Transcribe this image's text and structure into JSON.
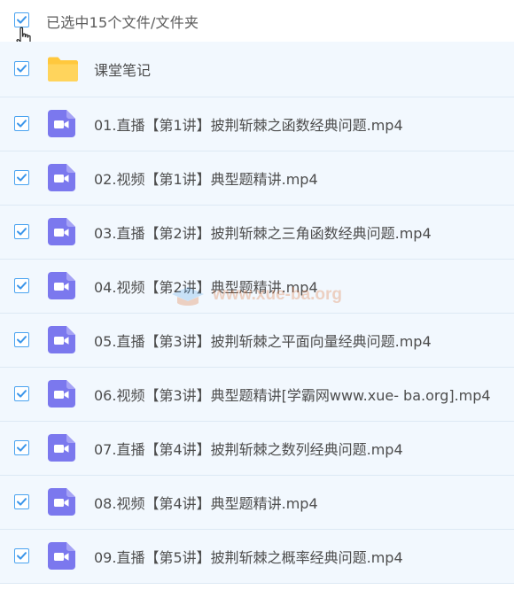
{
  "header": {
    "label": "已选中15个文件/文件夹"
  },
  "rows": [
    {
      "type": "folder",
      "label": "课堂笔记"
    },
    {
      "type": "video",
      "label": "01.直播【第1讲】披荆斩棘之函数经典问题.mp4"
    },
    {
      "type": "video",
      "label": "02.视频【第1讲】典型题精讲.mp4"
    },
    {
      "type": "video",
      "label": "03.直播【第2讲】披荆斩棘之三角函数经典问题.mp4"
    },
    {
      "type": "video",
      "label": "04.视频【第2讲】典型题精讲.mp4"
    },
    {
      "type": "video",
      "label": "05.直播【第3讲】披荆斩棘之平面向量经典问题.mp4"
    },
    {
      "type": "video",
      "label": "06.视频【第3讲】典型题精讲[学霸网www.xue- ba.org].mp4"
    },
    {
      "type": "video",
      "label": "07.直播【第4讲】披荆斩棘之数列经典问题.mp4"
    },
    {
      "type": "video",
      "label": "08.视频【第4讲】典型题精讲.mp4"
    },
    {
      "type": "video",
      "label": "09.直播【第5讲】披荆斩棘之概率经典问题.mp4"
    }
  ],
  "watermark": {
    "text": "www.xue-ba.org"
  },
  "colors": {
    "checkbox": "#4aa3f0",
    "video_icon": "#7b78ee",
    "folder_icon": "#ffcf4a",
    "row_bg": "#f2f8fe"
  }
}
